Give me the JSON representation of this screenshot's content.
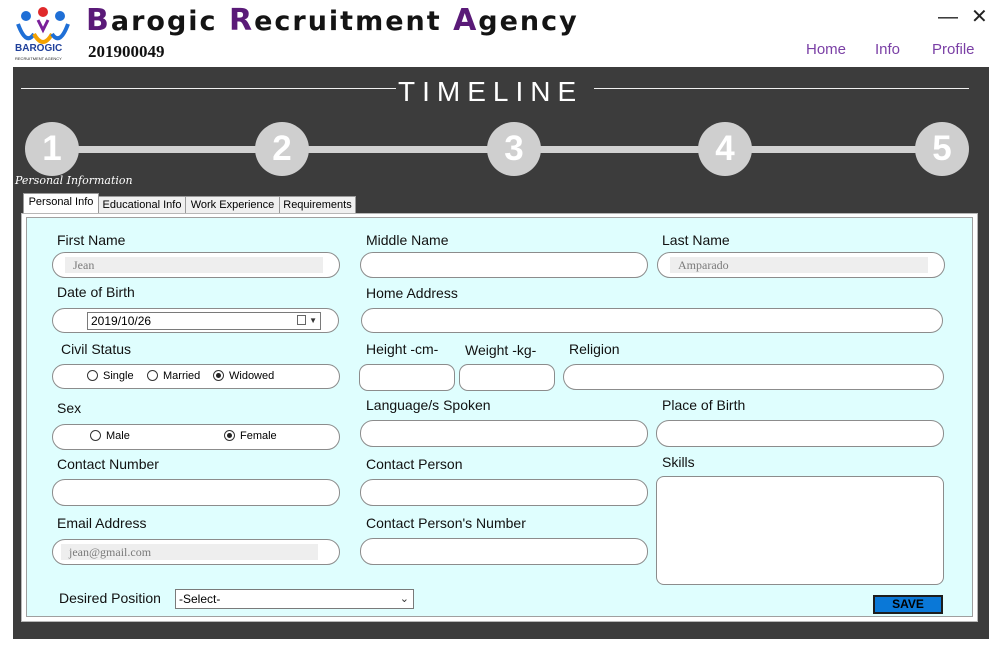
{
  "header": {
    "title_parts": [
      {
        "cap": "B",
        "rest": "arogic "
      },
      {
        "cap": "R",
        "rest": "ecruitment "
      },
      {
        "cap": "A",
        "rest": "gency"
      }
    ],
    "user_id": "201900049",
    "logo_text": "BAROGIC",
    "logo_subtext": "RECRUITMENT AGENCY",
    "minimize": "—",
    "close": "✕",
    "nav": [
      "Home",
      "Info",
      "Profile"
    ]
  },
  "timeline": {
    "title": "TIMELINE",
    "steps": [
      "1",
      "2",
      "3",
      "4",
      "5"
    ],
    "current_label": "Personal Information"
  },
  "tabs": [
    "Personal Info",
    "Educational Info",
    "Work Experience",
    "Requirements"
  ],
  "form": {
    "first_name": {
      "label": "First Name",
      "value": "Jean"
    },
    "middle_name": {
      "label": "Middle Name",
      "value": ""
    },
    "last_name": {
      "label": "Last Name",
      "value": "Amparado"
    },
    "dob": {
      "label": "Date of Birth",
      "value": "2019/10/26"
    },
    "home_address": {
      "label": "Home Address",
      "value": ""
    },
    "civil_status": {
      "label": "Civil Status",
      "options": [
        "Single",
        "Married",
        "Widowed"
      ],
      "selected": "Widowed"
    },
    "height": {
      "label": "Height -cm-"
    },
    "weight": {
      "label": "Weight  -kg-"
    },
    "religion": {
      "label": "Religion"
    },
    "sex": {
      "label": "Sex",
      "options": [
        "Male",
        "Female"
      ],
      "selected": "Female"
    },
    "languages": {
      "label": "Language/s Spoken"
    },
    "place_of_birth": {
      "label": "Place of Birth"
    },
    "contact_number": {
      "label": "Contact Number"
    },
    "contact_person": {
      "label": "Contact Person"
    },
    "skills": {
      "label": "Skills"
    },
    "email": {
      "label": "Email Address",
      "value": "jean@gmail.com"
    },
    "contact_person_number": {
      "label": "Contact Person's Number"
    },
    "desired_position": {
      "label": "Desired Position",
      "value": "-Select-"
    },
    "save_label": "SAVE"
  },
  "colors": {
    "accent": "#5a1a78",
    "nav": "#7a3fa5",
    "panel": "#3c3c3c",
    "form_bg": "#dffefe",
    "save": "#0a78d7"
  }
}
